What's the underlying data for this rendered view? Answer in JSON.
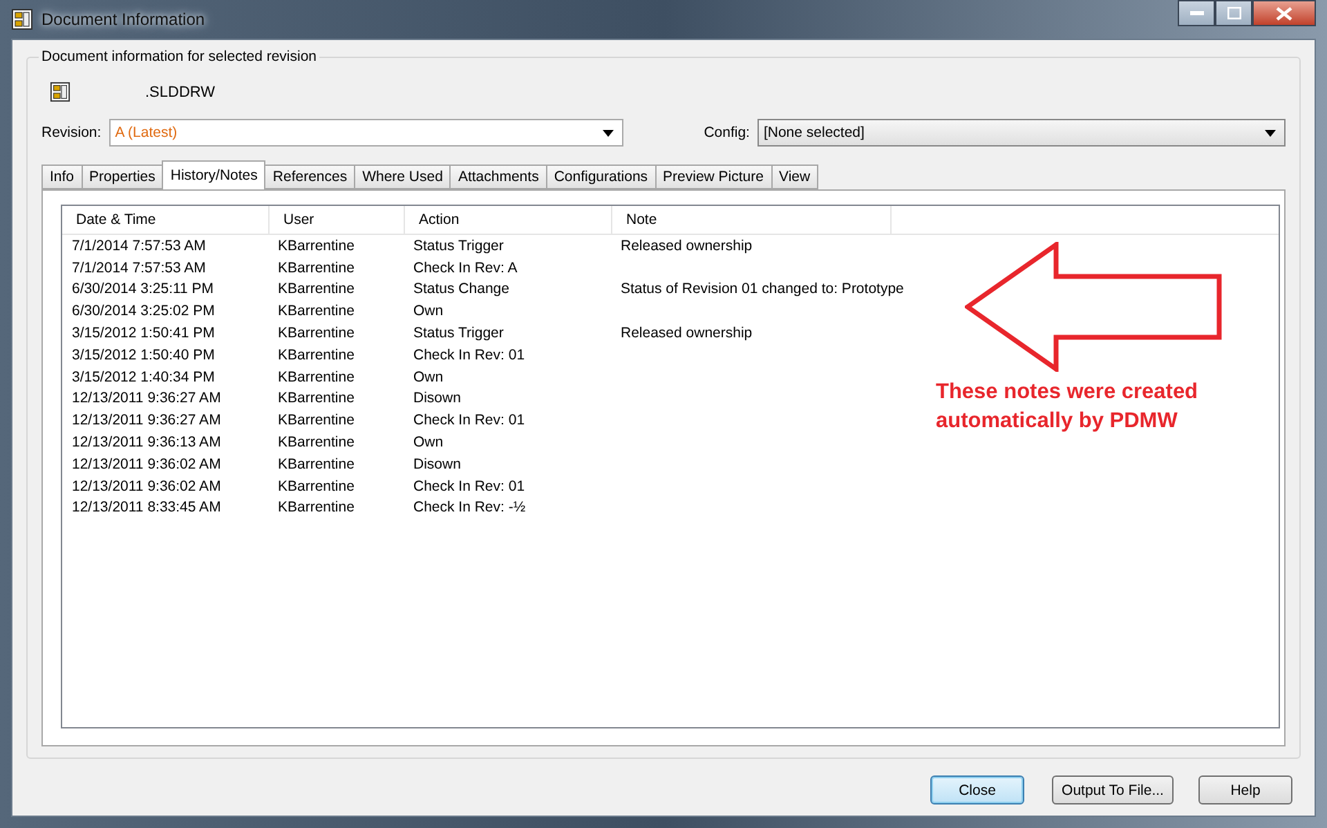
{
  "window": {
    "title": "Document Information"
  },
  "group": {
    "title": "Document information for selected revision"
  },
  "document": {
    "name": ".SLDDRW"
  },
  "revision": {
    "label": "Revision:",
    "value": "A (Latest)"
  },
  "config": {
    "label": "Config:",
    "value": "[None selected]"
  },
  "tabs": [
    {
      "label": "Info",
      "selected": false
    },
    {
      "label": "Properties",
      "selected": false
    },
    {
      "label": "History/Notes",
      "selected": true
    },
    {
      "label": "References",
      "selected": false
    },
    {
      "label": "Where Used",
      "selected": false
    },
    {
      "label": "Attachments",
      "selected": false
    },
    {
      "label": "Configurations",
      "selected": false
    },
    {
      "label": "Preview Picture",
      "selected": false
    },
    {
      "label": "View",
      "selected": false
    }
  ],
  "table": {
    "columns": [
      "Date & Time",
      "User",
      "Action",
      "Note"
    ],
    "rows": [
      [
        "7/1/2014 7:57:53 AM",
        "KBarrentine",
        "Status Trigger",
        "Released ownership"
      ],
      [
        "7/1/2014 7:57:53 AM",
        "KBarrentine",
        "Check In Rev: A",
        ""
      ],
      [
        "6/30/2014 3:25:11 PM",
        "KBarrentine",
        "Status Change",
        "Status of Revision 01 changed to: Prototype"
      ],
      [
        "6/30/2014 3:25:02 PM",
        "KBarrentine",
        "Own",
        ""
      ],
      [
        "3/15/2012 1:50:41 PM",
        "KBarrentine",
        "Status Trigger",
        "Released ownership"
      ],
      [
        "3/15/2012 1:50:40 PM",
        "KBarrentine",
        "Check In Rev: 01",
        ""
      ],
      [
        "3/15/2012 1:40:34 PM",
        "KBarrentine",
        "Own",
        ""
      ],
      [
        "12/13/2011 9:36:27 AM",
        "KBarrentine",
        "Disown",
        ""
      ],
      [
        "12/13/2011 9:36:27 AM",
        "KBarrentine",
        "Check In Rev: 01",
        ""
      ],
      [
        "12/13/2011 9:36:13 AM",
        "KBarrentine",
        "Own",
        ""
      ],
      [
        "12/13/2011 9:36:02 AM",
        "KBarrentine",
        "Disown",
        ""
      ],
      [
        "12/13/2011 9:36:02 AM",
        "KBarrentine",
        "Check In Rev: 01",
        ""
      ],
      [
        "12/13/2011 8:33:45 AM",
        "KBarrentine",
        "Check In Rev: -½",
        ""
      ]
    ]
  },
  "annotation": {
    "text": "These notes were created automatically by PDMW"
  },
  "buttons": [
    {
      "label": "Close",
      "selected": true
    },
    {
      "label": "Output To File...",
      "selected": false
    },
    {
      "label": "Help",
      "selected": false
    }
  ]
}
